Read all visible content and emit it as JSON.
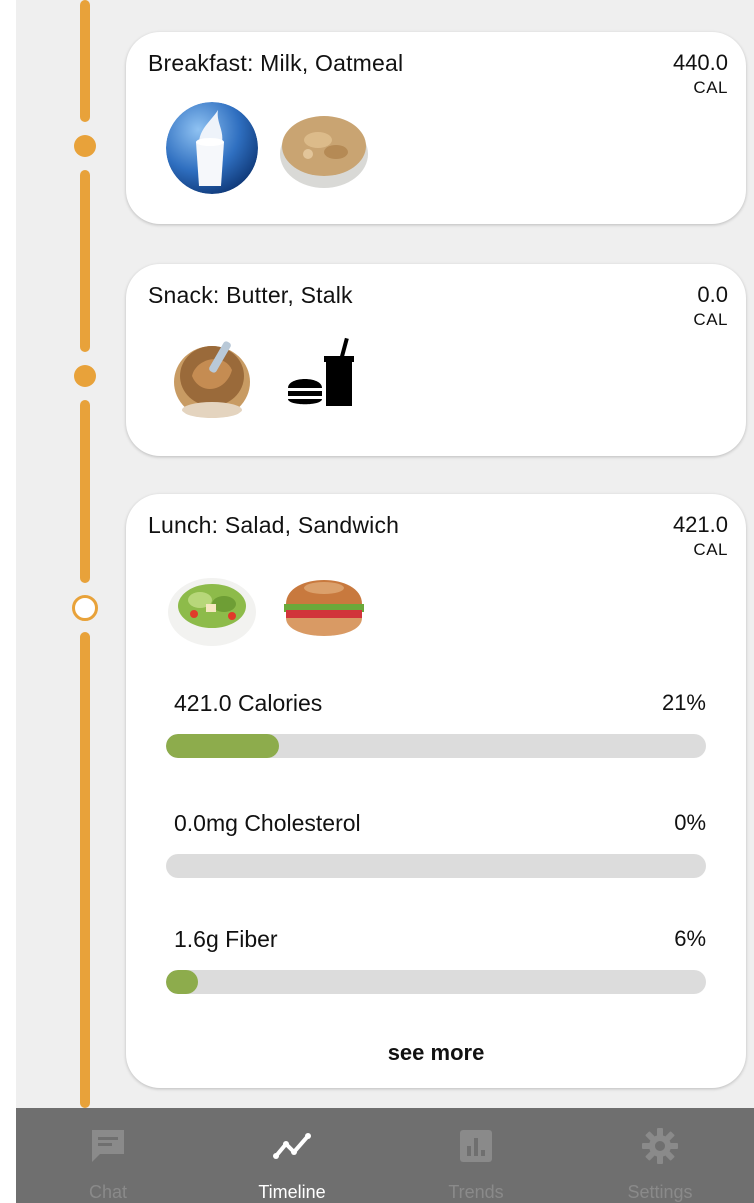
{
  "meals": [
    {
      "title": "Breakfast: Milk, Oatmeal",
      "calories": "440.0",
      "unit": "CAL",
      "foods": [
        "milk-image",
        "oatmeal-image"
      ]
    },
    {
      "title": "Snack: Butter, Stalk",
      "calories": "0.0",
      "unit": "CAL",
      "foods": [
        "butter-image",
        "fast-food-icon"
      ]
    },
    {
      "title": "Lunch: Salad, Sandwich",
      "calories": "421.0",
      "unit": "CAL",
      "foods": [
        "salad-image",
        "sandwich-image"
      ],
      "nutrients": [
        {
          "label": "421.0 Calories",
          "percent": "21%",
          "fill": 0.21
        },
        {
          "label": "0.0mg Cholesterol",
          "percent": "0%",
          "fill": 0.0
        },
        {
          "label": "1.6g Fiber",
          "percent": "6%",
          "fill": 0.06
        }
      ],
      "see_more": "see more"
    }
  ],
  "nav": {
    "items": [
      {
        "label": "Chat",
        "icon": "chat-icon",
        "active": false
      },
      {
        "label": "Timeline",
        "icon": "timeline-icon",
        "active": true
      },
      {
        "label": "Trends",
        "icon": "trends-icon",
        "active": false
      },
      {
        "label": "Settings",
        "icon": "gear-icon",
        "active": false
      }
    ]
  },
  "colors": {
    "timeline": "#e8a23a",
    "bar_fill": "#8dac4c",
    "bar_track": "#dcdcdc",
    "nav_bg": "#6f6f6f"
  }
}
